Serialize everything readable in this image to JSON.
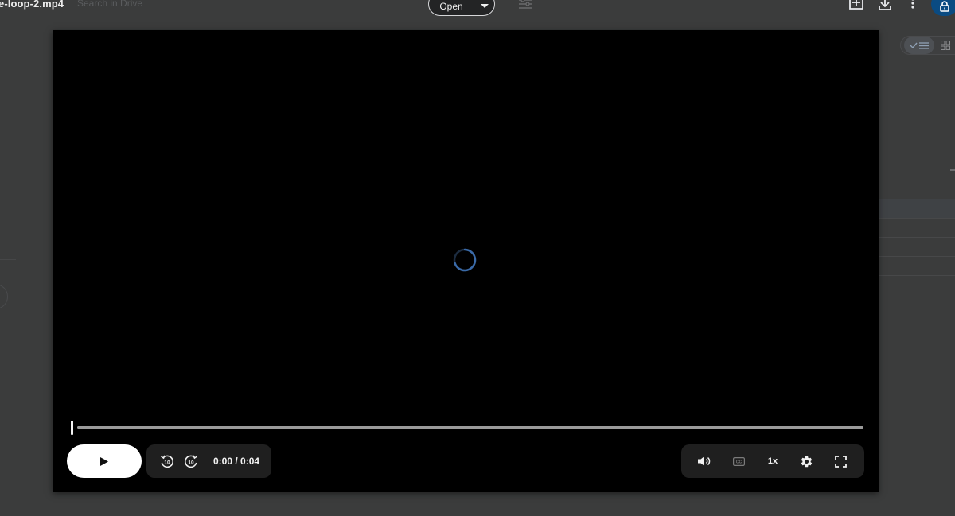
{
  "header": {
    "file_name": "e-loop-2.mp4",
    "search_placeholder": "Search in Drive",
    "open_label": "Open"
  },
  "player": {
    "state": "loading",
    "progress": 0,
    "current_time": "0:00",
    "duration": "0:04",
    "time_display": "0:00 / 0:04",
    "speed": "1x",
    "rewind_seconds": "10",
    "forward_seconds": "10"
  },
  "colors": {
    "backdrop": "#3b3c3c",
    "player_bg": "#000000",
    "control_bg": "#1f1f1f",
    "spinner_accent": "#3a6aa8",
    "lock_fab": "#0a4b82"
  },
  "icons": {
    "header": [
      "new-window-icon",
      "download-icon",
      "more-vert-icon",
      "lock-icon",
      "filter-icon",
      "caret-down-icon"
    ],
    "player": [
      "play-icon",
      "rewind-10-icon",
      "forward-10-icon",
      "volume-icon",
      "captions-icon",
      "settings-icon",
      "fullscreen-icon",
      "loading-spinner-icon"
    ]
  }
}
